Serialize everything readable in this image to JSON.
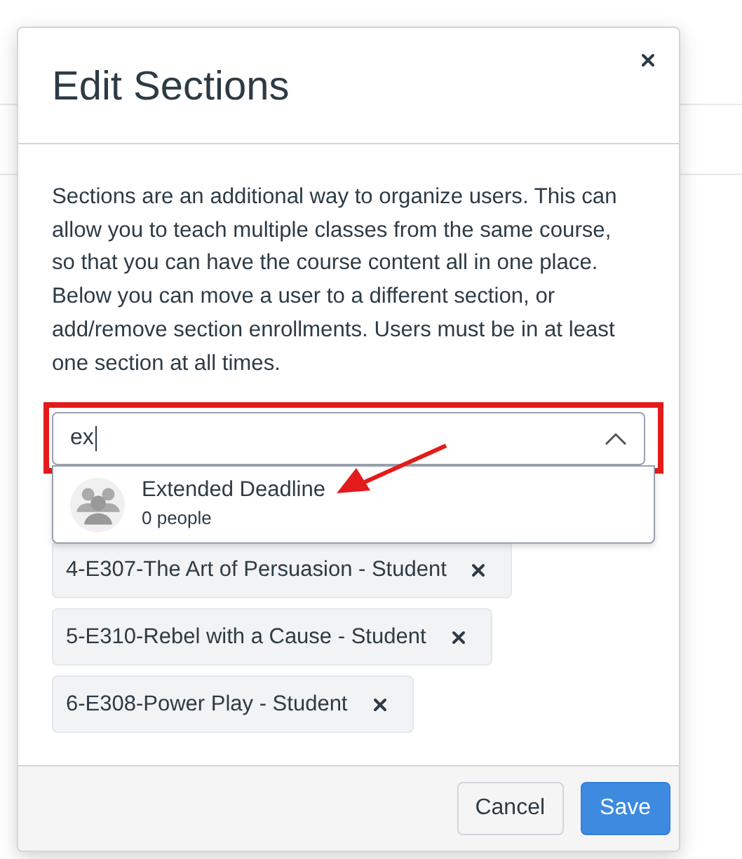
{
  "dialog": {
    "title": "Edit Sections",
    "description": "Sections are an additional way to organize users. This can allow you to teach multiple classes from the same course, so that you can have the course content all in one place. Below you can move a user to a different section, or add/remove section enrollments. Users must be in at least one section at all times.",
    "search": {
      "value": "ex",
      "expanded": true,
      "highlighted": true
    },
    "suggestions": [
      {
        "name": "Extended Deadline",
        "count": "0 people"
      }
    ],
    "sections": [
      {
        "label": "4-E307-The Art of Persuasion - Student"
      },
      {
        "label": "5-E310-Rebel with a Cause - Student"
      },
      {
        "label": "6-E308-Power Play - Student"
      }
    ],
    "buttons": [
      {
        "label": "Cancel",
        "kind": "secondary"
      },
      {
        "label": "Save",
        "kind": "primary"
      }
    ]
  }
}
